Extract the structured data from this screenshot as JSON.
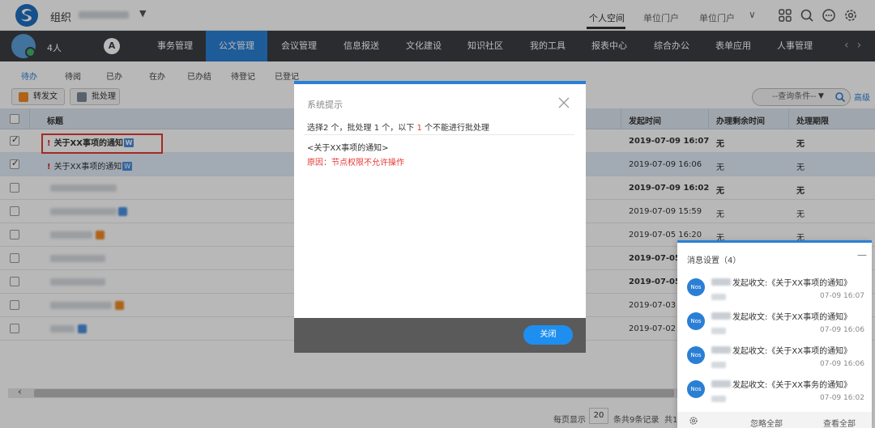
{
  "header": {
    "org_label": "组织",
    "links": [
      "个人空间",
      "单位门户",
      "单位门户"
    ]
  },
  "nav": {
    "user_count": "4人",
    "a_glyph": "A",
    "items": [
      "事务管理",
      "公文管理",
      "会议管理",
      "信息报送",
      "文化建设",
      "知识社区",
      "我的工具",
      "报表中心",
      "综合办公",
      "表单应用",
      "人事管理"
    ],
    "active_index": 1,
    "arrows": "<>"
  },
  "subtabs": [
    "待办",
    "待阅",
    "已办",
    "在办",
    "已办结",
    "待登记",
    "已登记"
  ],
  "toolbar": {
    "forward_label": "转发文",
    "batch_label": "批处理",
    "query_label": "--查询条件--",
    "advanced_label": "高级"
  },
  "table": {
    "columns": [
      "标题",
      "发起时间",
      "办理剩余时间",
      "处理期限"
    ],
    "rows": [
      {
        "title": "关于XX事项的通知",
        "w": "W",
        "time": "2019-07-09 16:07",
        "remain": "无",
        "deadline": "无",
        "checked": true,
        "bold": true,
        "flag": "!"
      },
      {
        "title": "关于XX事项的通知",
        "w": "W",
        "time": "2019-07-09 16:06",
        "remain": "无",
        "deadline": "无",
        "checked": true,
        "bold": false,
        "flag": "!"
      },
      {
        "time": "2019-07-09 16:02",
        "remain": "无",
        "deadline": "无",
        "bold": true
      },
      {
        "time": "2019-07-09 15:59",
        "remain": "无",
        "deadline": "无",
        "bold": false
      },
      {
        "time": "2019-07-05 16:20",
        "remain": "无",
        "deadline": "无",
        "bold": false
      },
      {
        "time": "2019-07-05 11",
        "remain": "",
        "deadline": "",
        "bold": true
      },
      {
        "time": "2019-07-05 11",
        "remain": "",
        "deadline": "",
        "bold": true
      },
      {
        "time": "2019-07-03 10",
        "remain": "",
        "deadline": "",
        "bold": false
      },
      {
        "time": "2019-07-02 15",
        "remain": "",
        "deadline": "",
        "bold": false
      }
    ]
  },
  "footer": {
    "per_page_label": "每页显示",
    "page_size": "20",
    "record_text": "条共9条记录",
    "total_prefix": "共1"
  },
  "dialog": {
    "title": "系统提示",
    "msg_part1": "选择2 个，批处理 1 个，以下 ",
    "msg_num": "1",
    "msg_part2": " 个不能进行批处理",
    "item": "<关于XX事项的通知>",
    "reason": "原因：节点权限不允许操作",
    "close_label": "关闭"
  },
  "messages": {
    "header": "消息设置（4）",
    "minimize": "—",
    "items": [
      {
        "avatar": "Nos",
        "text": "发起收文:《关于XX事项的通知》",
        "time": "07-09 16:07"
      },
      {
        "avatar": "Nos",
        "text": "发起收文:《关于XX事项的通知》",
        "time": "07-09 16:06"
      },
      {
        "avatar": "Nos",
        "text": "发起收文:《关于XX事项的通知》",
        "time": "07-09 16:06"
      },
      {
        "avatar": "Nos",
        "text": "发起收文:《关于XX事务的通知》",
        "time": "07-09 16:02"
      }
    ],
    "ignore_all": "忽略全部",
    "view_all": "查看全部"
  },
  "colors": {
    "accent": "#2a7fd4",
    "nav_bg": "#3b3e43",
    "alert_red": "#e53935"
  }
}
